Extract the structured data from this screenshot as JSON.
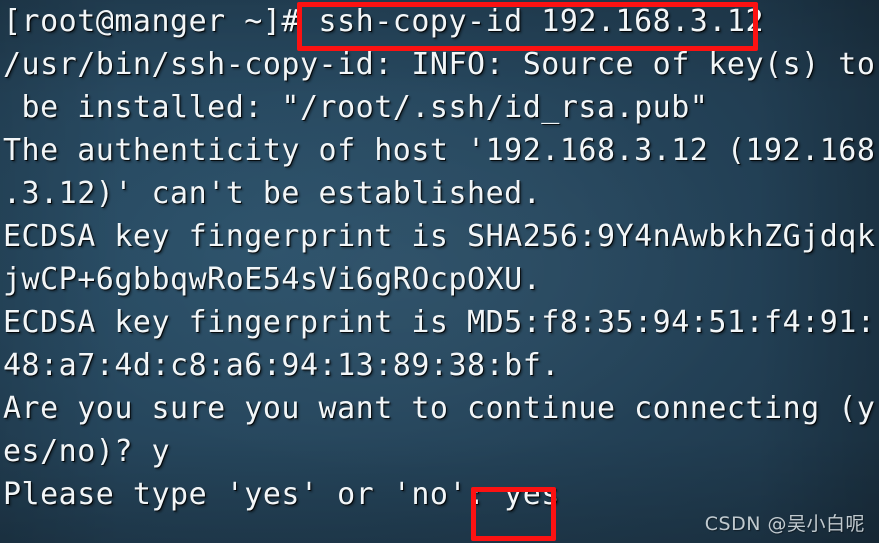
{
  "terminal": {
    "app_type": "ssh-terminal-session",
    "background_color": "#234257",
    "text_color": "#f2f6f8",
    "annotation_color": "#fc1212",
    "prompt": "[root@manger ~]# ",
    "command": "ssh-copy-id 192.168.3.12",
    "hostname": "manger",
    "user": "root",
    "lines": [
      {
        "id": "line-prompt",
        "text": "[root@manger ~]# ssh-copy-id 192.168.3.12"
      },
      {
        "id": "line-info-1",
        "text": "/usr/bin/ssh-copy-id: INFO: Source of key(s) to"
      },
      {
        "id": "line-info-2",
        "text": " be installed: \"/root/.ssh/id_rsa.pub\""
      },
      {
        "id": "line-authenticity-1",
        "text": "The authenticity of host '192.168.3.12 (192.168"
      },
      {
        "id": "line-authenticity-2",
        "text": ".3.12)' can't be established."
      },
      {
        "id": "line-sha256-1",
        "text": "ECDSA key fingerprint is SHA256:9Y4nAwbkhZGjdqk"
      },
      {
        "id": "line-sha256-2",
        "text": "jwCP+6gbbqwRoE54sVi6gROcpOXU."
      },
      {
        "id": "line-md5-1",
        "text": "ECDSA key fingerprint is MD5:f8:35:94:51:f4:91:"
      },
      {
        "id": "line-md5-2",
        "text": "48:a7:4d:c8:a6:94:13:89:38:bf."
      },
      {
        "id": "line-confirm-1",
        "text": "Are you sure you want to continue connecting (y"
      },
      {
        "id": "line-confirm-2",
        "text": "es/no)? y"
      },
      {
        "id": "line-retype",
        "text": "Please type 'yes' or 'no': yes"
      }
    ],
    "host_ip": "192.168.3.12",
    "key_path": "/root/.ssh/id_rsa.pub",
    "sha256_fingerprint": "SHA256:9Y4nAwbkhZGjdqkjwCP+6gbbqwRoE54sVi6gROcpOXU.",
    "md5_fingerprint": "MD5:f8:35:94:51:f4:91:48:a7:4d:c8:a6:94:13:89:38:bf.",
    "user_answer_short": "y",
    "user_answer_full": "yes"
  },
  "annotations": [
    {
      "id": "annot-command",
      "label": "ssh-copy-id 192.168.3.12"
    },
    {
      "id": "annot-answer",
      "label": "yes"
    }
  ],
  "watermark": {
    "text": "CSDN @吴小白呢"
  }
}
